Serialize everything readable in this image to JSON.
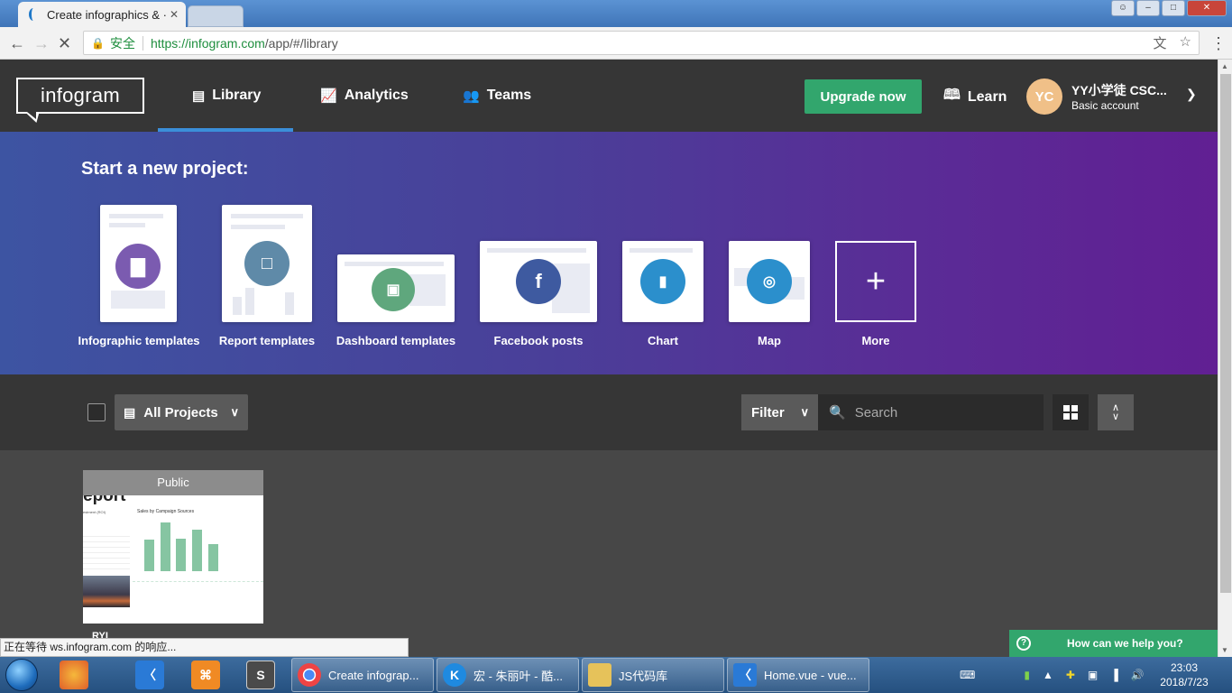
{
  "browser": {
    "tab_title": "Create infographics & ·",
    "url_secure_label": "安全",
    "url_host": "https://infogram.com",
    "url_path": "/app/#/library"
  },
  "header": {
    "logo": "infogram",
    "nav": [
      {
        "label": "Library",
        "icon": "library-icon",
        "active": true
      },
      {
        "label": "Analytics",
        "icon": "analytics-icon",
        "active": false
      },
      {
        "label": "Teams",
        "icon": "teams-icon",
        "active": false
      }
    ],
    "upgrade_label": "Upgrade now",
    "learn_label": "Learn",
    "avatar_initials": "YC",
    "user_name": "YY小学徒 CSC...",
    "account_type": "Basic account"
  },
  "hero": {
    "title": "Start a new project:",
    "templates": [
      {
        "label": "Infographic templates",
        "icon": "bar-chart-icon",
        "color": "#7b5bb0"
      },
      {
        "label": "Report templates",
        "icon": "document-icon",
        "color": "#5f8aa8"
      },
      {
        "label": "Dashboard templates",
        "icon": "dashboard-icon",
        "color": "#5fa77d"
      },
      {
        "label": "Facebook posts",
        "icon": "facebook-icon",
        "color": "#3e5aa0"
      },
      {
        "label": "Chart",
        "icon": "chart-icon",
        "color": "#2b8fcc"
      },
      {
        "label": "Map",
        "icon": "map-icon",
        "color": "#2b8fcc"
      },
      {
        "label": "More",
        "icon": "plus-icon",
        "color": "#ffffff"
      }
    ]
  },
  "toolbar": {
    "projects_dropdown": "All Projects",
    "filter_label": "Filter",
    "search_placeholder": "Search"
  },
  "projects": [
    {
      "badge": "Public",
      "thumb_title": "eport",
      "thumb_subtitle": "estment (ROI)",
      "thumb_chart_title": "Sales by Campaign Sources",
      "caption": "RYI"
    }
  ],
  "status_text": "正在等待 ws.infogram.com 的响应...",
  "help_label": "How can we help you?",
  "taskbar": {
    "tasks": [
      {
        "label": "Create infograp...",
        "icon_color": "#e9e9e9"
      },
      {
        "label": "宏 - 朱丽叶 - 酷...",
        "icon_color": "#1f8ae0"
      },
      {
        "label": "JS代码库",
        "icon_color": "#e6c25a"
      },
      {
        "label": "Home.vue - vue...",
        "icon_color": "#2a7ad6"
      }
    ],
    "time": "23:03",
    "date": "2018/7/23"
  }
}
